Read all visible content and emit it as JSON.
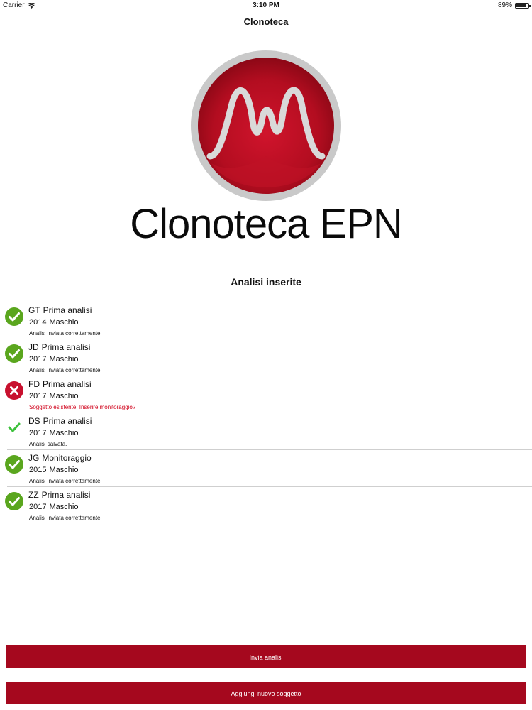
{
  "status_bar": {
    "carrier": "Carrier",
    "time": "3:10 PM",
    "battery": "89%",
    "battery_level": 0.89
  },
  "nav": {
    "title": "Clonoteca"
  },
  "logo": {
    "text": "Clonoteca EPN"
  },
  "section_title": "Analisi inserite",
  "analyses": [
    {
      "initials": "GT",
      "type": "Prima analisi",
      "year": "2014",
      "sex": "Maschio",
      "status": "sent",
      "message": "Analisi inviata correttamente."
    },
    {
      "initials": "JD",
      "type": "Prima analisi",
      "year": "2017",
      "sex": "Maschio",
      "status": "sent",
      "message": "Analisi inviata correttamente."
    },
    {
      "initials": "FD",
      "type": "Prima analisi",
      "year": "2017",
      "sex": "Maschio",
      "status": "error",
      "message": "Soggetto esistente! Inserire monitoraggio?"
    },
    {
      "initials": "DS",
      "type": "Prima analisi",
      "year": "2017",
      "sex": "Maschio",
      "status": "saved",
      "message": "Analisi salvata."
    },
    {
      "initials": "JG",
      "type": "Monitoraggio",
      "year": "2015",
      "sex": "Maschio",
      "status": "sent",
      "message": "Analisi inviata correttamente."
    },
    {
      "initials": "ZZ",
      "type": "Prima analisi",
      "year": "2017",
      "sex": "Maschio",
      "status": "sent",
      "message": "Analisi inviata correttamente."
    }
  ],
  "buttons": {
    "send": "Invia analisi",
    "add": "Aggiungi nuovo soggetto"
  },
  "colors": {
    "accent": "#a5081e",
    "success": "#5aa61e",
    "error": "#c8102e",
    "saved": "#3cc13b"
  }
}
